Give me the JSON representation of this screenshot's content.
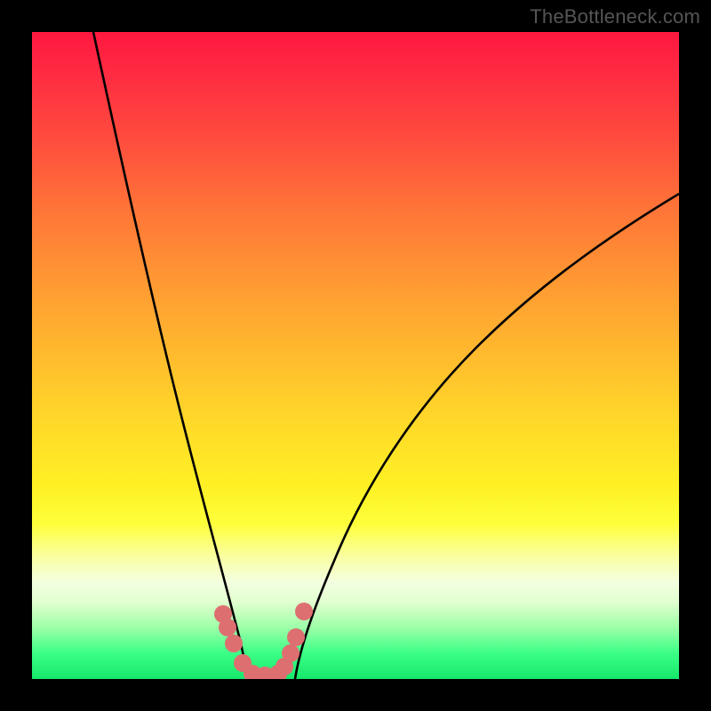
{
  "watermark": "TheBottleneck.com",
  "chart_data": {
    "type": "line",
    "title": "",
    "xlabel": "",
    "ylabel": "",
    "xlim": [
      0,
      100
    ],
    "ylim": [
      0,
      100
    ],
    "grid": false,
    "series": [
      {
        "name": "left-curve",
        "x": [
          9.5,
          12,
          15,
          18,
          21,
          24,
          26,
          28,
          30,
          31.5,
          33.5
        ],
        "y": [
          100,
          88,
          74,
          60,
          46,
          32,
          22,
          14,
          8,
          4,
          0
        ]
      },
      {
        "name": "right-curve",
        "x": [
          40.7,
          42,
          45,
          50,
          56,
          63,
          71,
          80,
          90,
          100
        ],
        "y": [
          0,
          5,
          14,
          25,
          36,
          46,
          55,
          63,
          70,
          75
        ]
      },
      {
        "name": "marker-dots",
        "x": [
          29.5,
          30.2,
          31.2,
          32.5,
          34.0,
          36.0,
          38.0,
          39.0,
          40.0,
          40.8,
          42.0
        ],
        "y": [
          10.0,
          8.0,
          5.5,
          2.5,
          0.8,
          0.5,
          0.8,
          2.0,
          4.0,
          6.5,
          10.5
        ]
      }
    ],
    "background_gradient": {
      "orientation": "vertical",
      "stops": [
        {
          "pos": 0.0,
          "color": "#ff183f"
        },
        {
          "pos": 0.27,
          "color": "#ff7338"
        },
        {
          "pos": 0.6,
          "color": "#ffd829"
        },
        {
          "pos": 0.82,
          "color": "#faffa0"
        },
        {
          "pos": 1.0,
          "color": "#15e86b"
        }
      ]
    }
  }
}
